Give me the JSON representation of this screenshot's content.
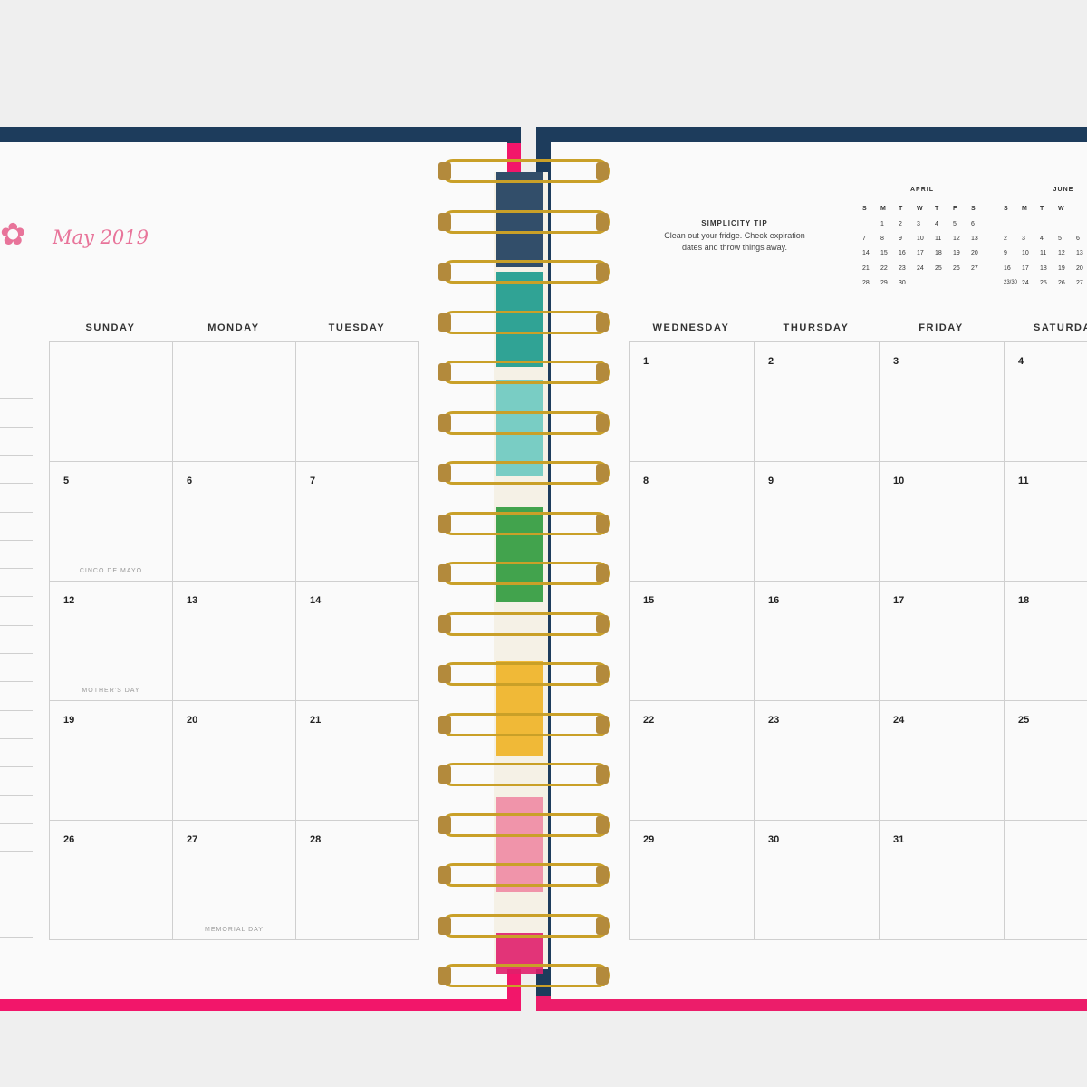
{
  "left_page": {
    "month_title": "May 2019",
    "headers": [
      "SUNDAY",
      "MONDAY",
      "TUESDAY"
    ],
    "weeks": [
      [
        {
          "day": ""
        },
        {
          "day": ""
        },
        {
          "day": ""
        }
      ],
      [
        {
          "day": "5",
          "holiday": "CINCO DE MAYO"
        },
        {
          "day": "6"
        },
        {
          "day": "7"
        }
      ],
      [
        {
          "day": "12",
          "holiday": "MOTHER'S DAY"
        },
        {
          "day": "13"
        },
        {
          "day": "14"
        }
      ],
      [
        {
          "day": "19"
        },
        {
          "day": "20"
        },
        {
          "day": "21"
        }
      ],
      [
        {
          "day": "26"
        },
        {
          "day": "27",
          "holiday": "MEMORIAL DAY"
        },
        {
          "day": "28"
        }
      ]
    ]
  },
  "right_page": {
    "tip": {
      "title": "SIMPLICITY TIP",
      "body": "Clean out your fridge. Check expiration dates and throw things away."
    },
    "mini_calendars": [
      {
        "title": "APRIL",
        "headers": [
          "S",
          "M",
          "T",
          "W",
          "T",
          "F",
          "S"
        ],
        "rows": [
          [
            "",
            "1",
            "2",
            "3",
            "4",
            "5",
            "6"
          ],
          [
            "7",
            "8",
            "9",
            "10",
            "11",
            "12",
            "13"
          ],
          [
            "14",
            "15",
            "16",
            "17",
            "18",
            "19",
            "20"
          ],
          [
            "21",
            "22",
            "23",
            "24",
            "25",
            "26",
            "27"
          ],
          [
            "28",
            "29",
            "30",
            "",
            "",
            "",
            ""
          ]
        ]
      },
      {
        "title": "JUNE",
        "headers": [
          "S",
          "M",
          "T",
          "W"
        ],
        "rows": [
          [
            "",
            "",
            "",
            ""
          ],
          [
            "2",
            "3",
            "4",
            "5",
            "6"
          ],
          [
            "9",
            "10",
            "11",
            "12",
            "13"
          ],
          [
            "16",
            "17",
            "18",
            "19",
            "20"
          ],
          [
            "23/30",
            "24",
            "25",
            "26",
            "27"
          ]
        ]
      }
    ],
    "headers": [
      "WEDNESDAY",
      "THURSDAY",
      "FRIDAY",
      "SATURDAY"
    ],
    "weeks": [
      [
        {
          "day": "1"
        },
        {
          "day": "2"
        },
        {
          "day": "3"
        },
        {
          "day": "4"
        }
      ],
      [
        {
          "day": "8"
        },
        {
          "day": "9"
        },
        {
          "day": "10"
        },
        {
          "day": "11"
        }
      ],
      [
        {
          "day": "15"
        },
        {
          "day": "16"
        },
        {
          "day": "17"
        },
        {
          "day": "18"
        }
      ],
      [
        {
          "day": "22"
        },
        {
          "day": "23"
        },
        {
          "day": "24"
        },
        {
          "day": "25"
        }
      ],
      [
        {
          "day": "29"
        },
        {
          "day": "30"
        },
        {
          "day": "31"
        },
        {
          "day": ""
        }
      ]
    ]
  },
  "colors": {
    "pink_accent": "#e8749a",
    "navy_cover": "#1d3c5c",
    "magenta_cover": "#f2166a",
    "gold_ring": "#c9a028",
    "tab_colors": [
      "#1d3c5c",
      "#1b9a8c",
      "#6cc9c0",
      "#2f9a3c",
      "#f0b323",
      "#f08aa3",
      "#e01f6b"
    ]
  }
}
